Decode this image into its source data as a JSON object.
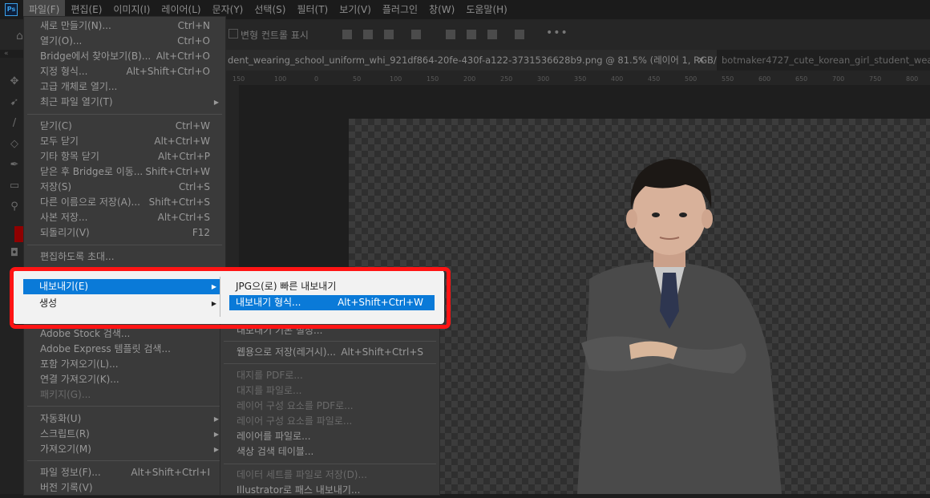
{
  "app": {
    "logo": "Ps"
  },
  "menubar": [
    "파일(F)",
    "편집(E)",
    "이미지(I)",
    "레이어(L)",
    "문자(Y)",
    "선택(S)",
    "필터(T)",
    "보기(V)",
    "플러그인",
    "창(W)",
    "도움말(H)"
  ],
  "optbar": {
    "label": "변형 컨트롤 표시",
    "more": "•••"
  },
  "tabs": [
    {
      "title": "dent_wearing_school_uniform_whi_921df864-20fe-430f-a122-3731536628b9.png @ 81.5% (레이어 1, RGB/8#) *",
      "close": "×"
    },
    {
      "title": "botmaker4727_cute_korean_girl_student_wearing"
    }
  ],
  "ruler": [
    "150",
    "100",
    "50",
    "0",
    "50",
    "100",
    "150",
    "200",
    "250",
    "300",
    "350",
    "400",
    "450",
    "500",
    "550",
    "600",
    "650",
    "700",
    "750",
    "800",
    "850",
    "900"
  ],
  "file_menu": {
    "items": [
      {
        "label": "새로 만들기(N)...",
        "shortcut": "Ctrl+N"
      },
      {
        "label": "열기(O)...",
        "shortcut": "Ctrl+O"
      },
      {
        "label": "Bridge에서 찾아보기(B)...",
        "shortcut": "Alt+Ctrl+O"
      },
      {
        "label": "지정 형식...",
        "shortcut": "Alt+Shift+Ctrl+O"
      },
      {
        "label": "고급 개체로 열기..."
      },
      {
        "label": "최근 파일 열기(T)",
        "arrow": "▶"
      },
      {
        "label": "닫기(C)",
        "shortcut": "Ctrl+W"
      },
      {
        "label": "모두 닫기",
        "shortcut": "Alt+Ctrl+W"
      },
      {
        "label": "기타 항목 닫기",
        "shortcut": "Alt+Ctrl+P"
      },
      {
        "label": "닫은 후 Bridge로 이동...",
        "shortcut": "Shift+Ctrl+W"
      },
      {
        "label": "저장(S)",
        "shortcut": "Ctrl+S"
      },
      {
        "label": "다른 이름으로 저장(A)...",
        "shortcut": "Shift+Ctrl+S"
      },
      {
        "label": "사본 저장...",
        "shortcut": "Alt+Ctrl+S"
      },
      {
        "label": "되돌리기(V)",
        "shortcut": "F12"
      },
      {
        "label": "편집하도록 초대..."
      },
      {
        "label": "내보내기(E)",
        "arrow": "▶"
      },
      {
        "label": "생성",
        "arrow": "▶"
      },
      {
        "label": "Adobe Stock 검색..."
      },
      {
        "label": "Adobe Express 템플릿 검색..."
      },
      {
        "label": "포함 가져오기(L)..."
      },
      {
        "label": "연결 가져오기(K)..."
      },
      {
        "label": "패키지(G)..."
      },
      {
        "label": "자동화(U)",
        "arrow": "▶"
      },
      {
        "label": "스크립트(R)",
        "arrow": "▶"
      },
      {
        "label": "가져오기(M)",
        "arrow": "▶"
      },
      {
        "label": "파일 정보(F)...",
        "shortcut": "Alt+Shift+Ctrl+I"
      },
      {
        "label": "버전 기록(V)"
      }
    ]
  },
  "export_submenu": {
    "items": [
      {
        "label": "JPG으(로) 빠른 내보내기"
      },
      {
        "label": "내보내기 형식...",
        "shortcut": "Alt+Shift+Ctrl+W"
      },
      {
        "label": "내보내기 기본 설정..."
      },
      {
        "label": "웹용으로 저장(레거시)...",
        "shortcut": "Alt+Shift+Ctrl+S"
      },
      {
        "label": "대지를 PDF로..."
      },
      {
        "label": "대지를 파일로..."
      },
      {
        "label": "레이어 구성 요소를 PDF로..."
      },
      {
        "label": "레이어 구성 요소를 파일로..."
      },
      {
        "label": "레이어를 파일로..."
      },
      {
        "label": "색상 검색 테이블..."
      },
      {
        "label": "데이터 세트를 파일로 저장(D)..."
      },
      {
        "label": "Illustrator로 패스 내보내기..."
      }
    ]
  },
  "colors": {
    "highlight": "#0a7ad8",
    "annotation": "#ff1414"
  }
}
